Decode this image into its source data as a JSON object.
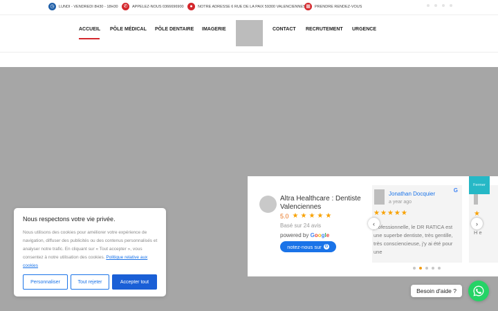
{
  "topbar": {
    "items": [
      {
        "icon": "clock-icon",
        "text": "LUNDI - VENDREDI 8H30 - 18H30"
      },
      {
        "icon": "phone-icon",
        "text": "APPELEZ-NOUS 0366696900"
      },
      {
        "icon": "location-pin-icon",
        "text": "NOTRE ADRESSE 6 RUE DE LA PAIX 59300 VALENCIENNES"
      },
      {
        "icon": "calendar-icon",
        "text": "PRENDRE RENDEZ-VOUS"
      }
    ]
  },
  "nav": {
    "items": [
      "ACCUEIL",
      "PÔLE MÉDICAL",
      "PÔLE DENTAIRE",
      "IMAGERIE",
      "CONTACT",
      "RECRUTEMENT",
      "URGENCE"
    ],
    "active_index": 0,
    "accent_color": "#d4272c"
  },
  "reviews": {
    "business_name": "Altra Healthcare : Dentiste Valenciennes",
    "rating": "5.0",
    "based_on": "Basé sur 24 avis",
    "powered_by": "powered by",
    "google_word": "Google",
    "button_label": "notez-nous sur",
    "review": {
      "author": "Jonathan Docquier",
      "time": "a year ago",
      "stars": 5,
      "text": "professionnelle, le DR RATICA est une superbe dentiste, très gentille, très consciencieuse, j'y ai été pour une"
    },
    "next_review_text": "H e",
    "carousel_dots": 5,
    "active_dot": 1
  },
  "side_tab": {
    "label": "Fermer"
  },
  "cookie": {
    "title": "Nous respectons votre vie privée.",
    "body": "Nous utilisons des cookies pour améliorer votre expérience de navigation, diffuser des publicités ou des contenus personnalisés et analyser notre trafic. En cliquant sur « Tout accepter », vous consentez à notre utilisation des cookies.",
    "link": "Politique relative aux cookies",
    "customize": "Personnaliser",
    "reject": "Tout rejeter",
    "accept": "Accepter tout"
  },
  "whatsapp": {
    "help_label": "Besoin d'aide ?",
    "color": "#25d366"
  }
}
